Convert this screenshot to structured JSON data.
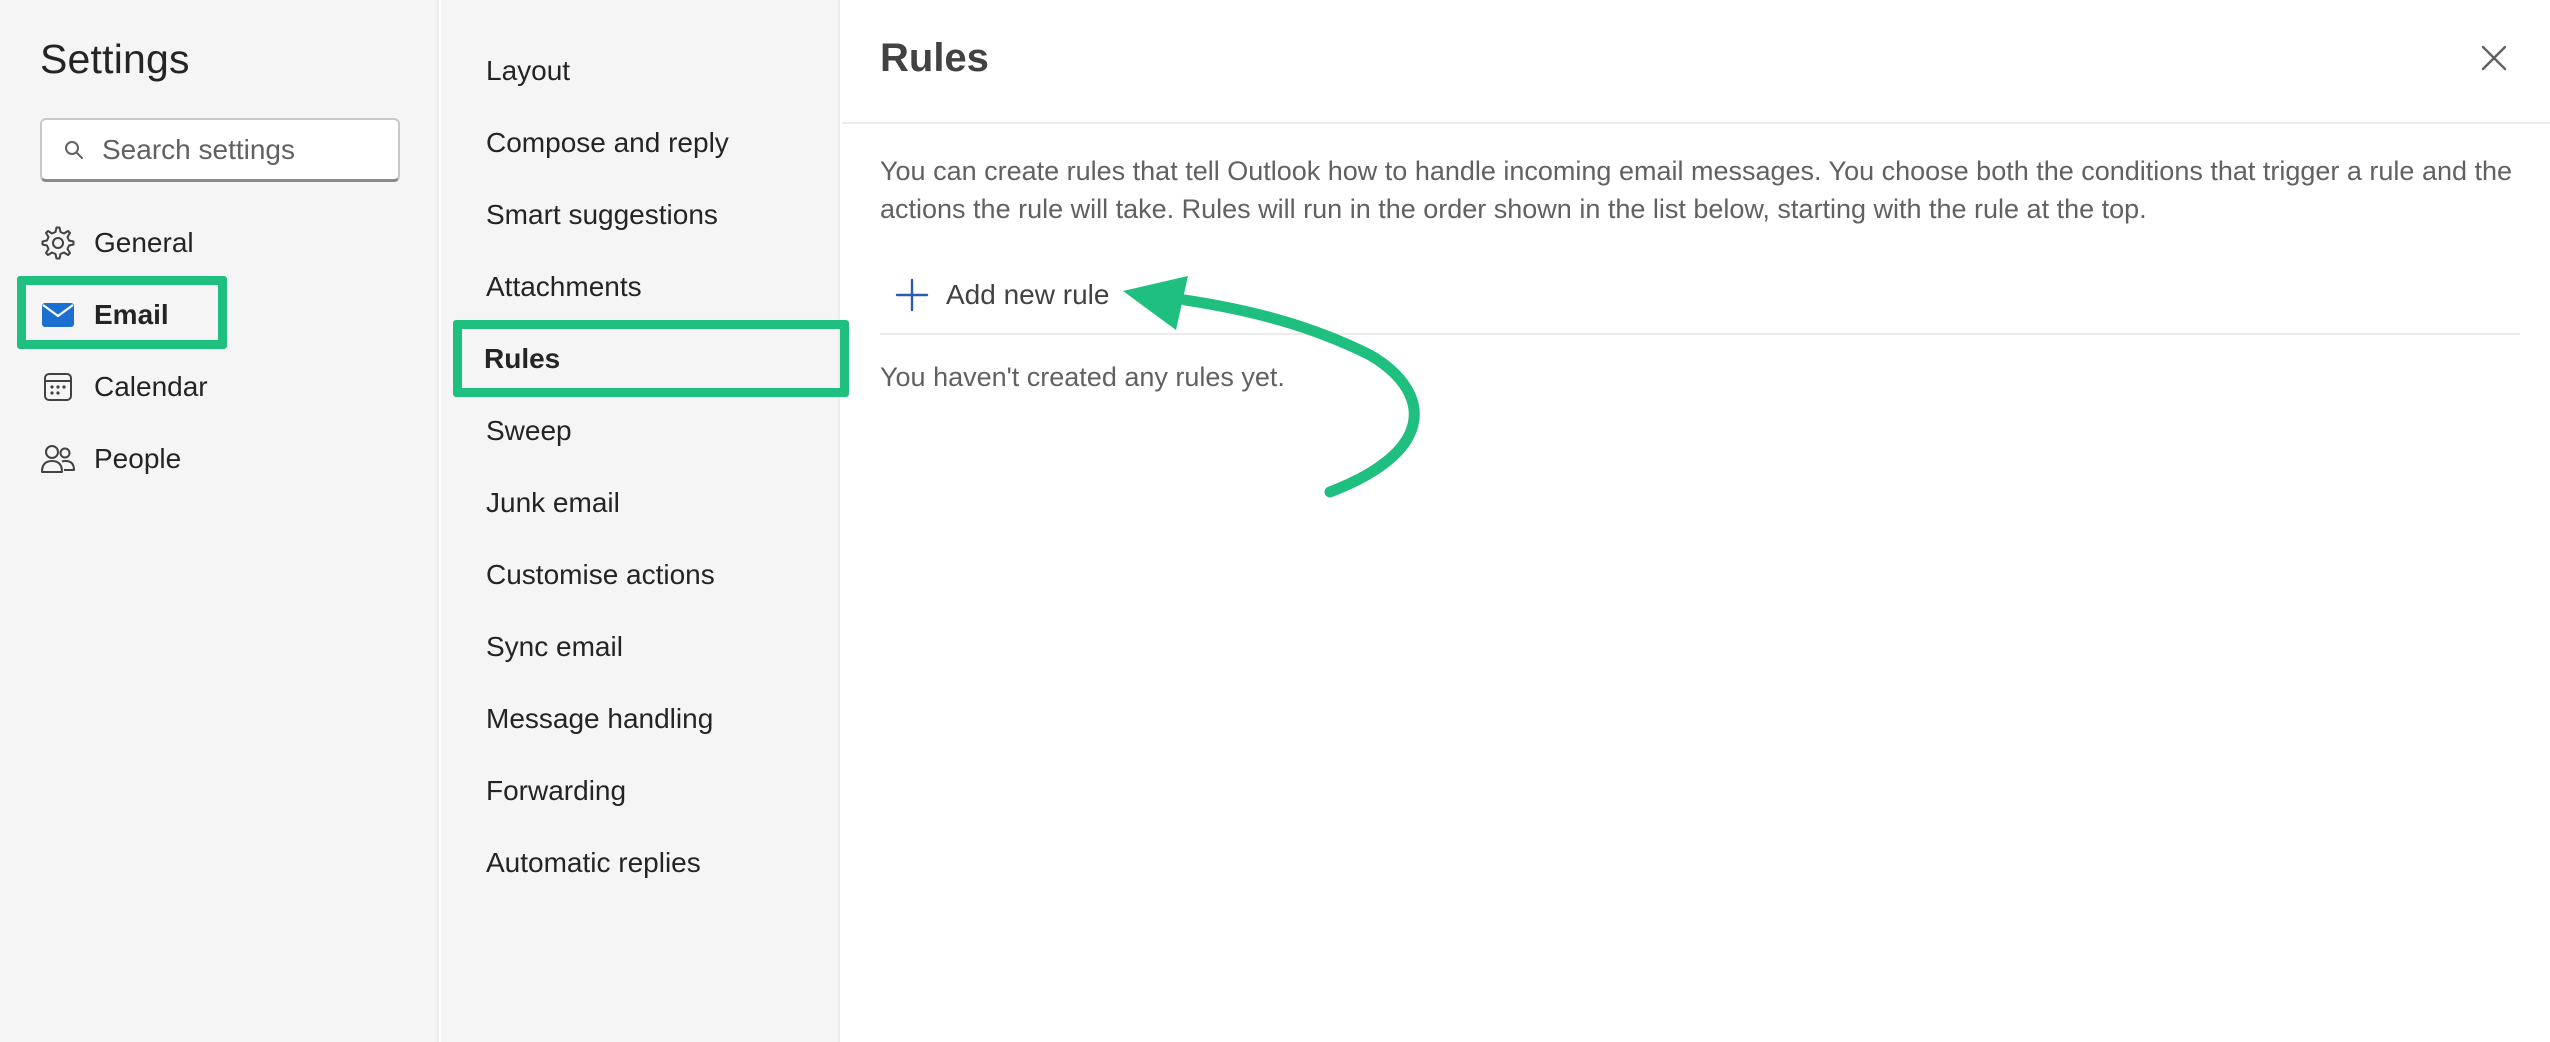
{
  "settings": {
    "title": "Settings",
    "search_placeholder": "Search settings"
  },
  "nav": {
    "items": [
      {
        "label": "General",
        "icon": "gear-icon"
      },
      {
        "label": "Email",
        "icon": "mail-icon",
        "active": true
      },
      {
        "label": "Calendar",
        "icon": "calendar-icon"
      },
      {
        "label": "People",
        "icon": "people-icon"
      }
    ]
  },
  "subnav": {
    "items": [
      {
        "label": "Layout"
      },
      {
        "label": "Compose and reply"
      },
      {
        "label": "Smart suggestions"
      },
      {
        "label": "Attachments"
      },
      {
        "label": "Rules",
        "active": true
      },
      {
        "label": "Sweep"
      },
      {
        "label": "Junk email"
      },
      {
        "label": "Customise actions"
      },
      {
        "label": "Sync email"
      },
      {
        "label": "Message handling"
      },
      {
        "label": "Forwarding"
      },
      {
        "label": "Automatic replies"
      }
    ]
  },
  "main": {
    "title": "Rules",
    "description": "You can create rules that tell Outlook how to handle incoming email messages. You choose both the conditions that trigger a rule and the actions the rule will take. Rules will run in the order shown in the list below, starting with the rule at the top.",
    "add_rule_label": "Add new rule",
    "empty_message": "You haven't created any rules yet."
  },
  "colors": {
    "highlight": "#1fbf7f",
    "mail_icon": "#1a6fd1",
    "nav_background": "#f5f5f5"
  }
}
